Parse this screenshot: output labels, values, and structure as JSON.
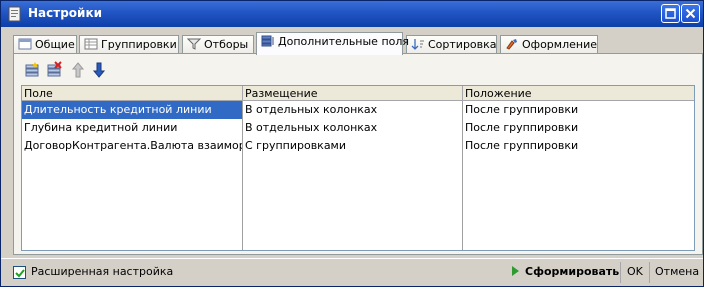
{
  "window": {
    "title": "Настройки"
  },
  "tabs": [
    {
      "label": "Общие",
      "icon": "general-icon"
    },
    {
      "label": "Группировки",
      "icon": "groupings-icon"
    },
    {
      "label": "Отборы",
      "icon": "filter-icon"
    },
    {
      "label": "Дополнительные поля",
      "icon": "additional-fields-icon",
      "active": true
    },
    {
      "label": "Сортировка",
      "icon": "sort-icon"
    },
    {
      "label": "Оформление",
      "icon": "appearance-icon"
    }
  ],
  "toolbar": {
    "buttons": [
      "add-row-icon",
      "delete-row-icon",
      "move-up-icon",
      "move-down-icon"
    ]
  },
  "grid": {
    "columns": [
      "Поле",
      "Размещение",
      "Положение"
    ],
    "rows": [
      [
        "Длительность кредитной линии",
        "В отдельных колонках",
        "После группировки"
      ],
      [
        "Глубина кредитной линии",
        "В отдельных колонках",
        "После группировки"
      ],
      [
        "ДоговорКонтрагента.Валюта взаиморас...",
        "С группировками",
        "После группировки"
      ]
    ],
    "selected_row": 0
  },
  "footer": {
    "advanced_label": "Расширенная настройка",
    "advanced_checked": true,
    "run_label": "Сформировать",
    "ok_label": "OK",
    "cancel_label": "Отмена"
  },
  "colors": {
    "title_bar": "#0d3fa8",
    "selection": "#316ac5",
    "run_arrow": "#2f9a2f"
  }
}
